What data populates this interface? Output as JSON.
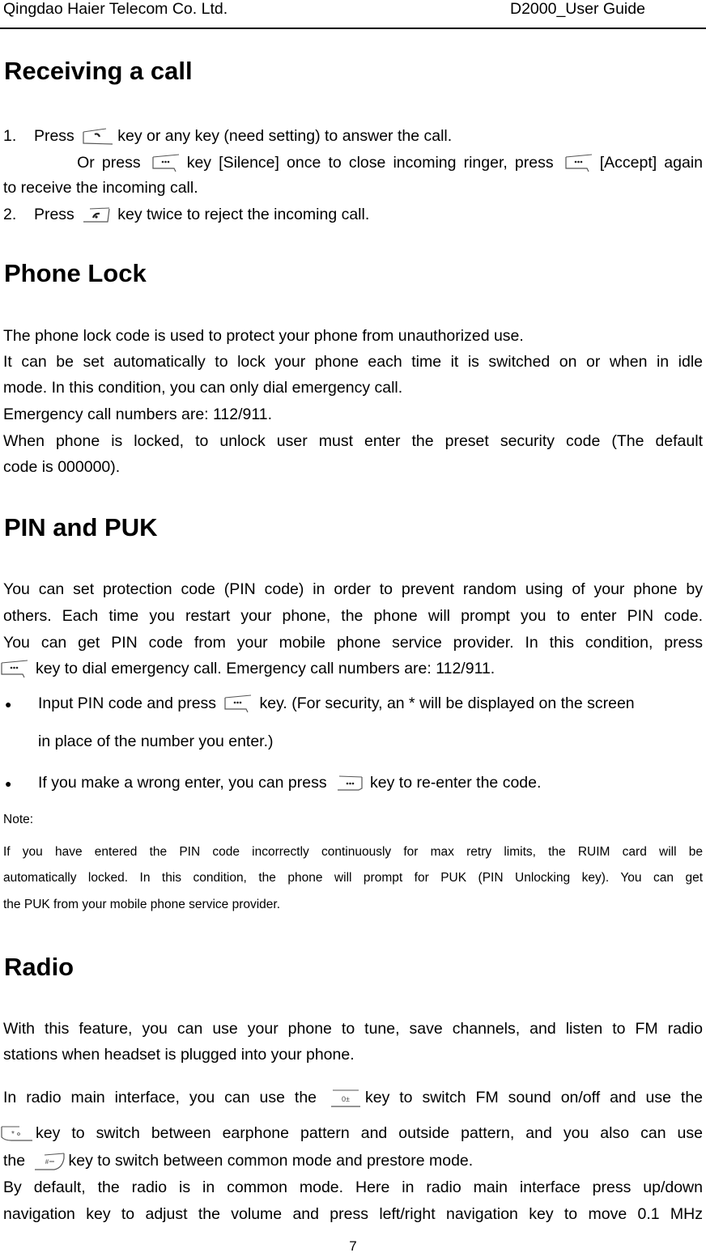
{
  "header": {
    "company": "Qingdao Haier Telecom Co. Ltd.",
    "doc_title": "D2000_User Guide"
  },
  "receiving": {
    "title": "Receiving a call",
    "l1_num": "1.",
    "l1_a": "Press",
    "l1_b": "key or any key (need setting) to answer the call.",
    "l2_a": "Or press",
    "l2_b": "key [Silence] once to close incoming ringer, press",
    "l2_c": "[Accept] again",
    "l3": "to receive the incoming call.",
    "l4_num": "2.",
    "l4_a": "Press",
    "l4_b": "key twice to reject the incoming call."
  },
  "phone_lock": {
    "title": "Phone Lock",
    "lines": [
      "The phone lock code is used to protect your phone from unauthorized use.",
      "It can be set automatically to lock your phone each time it is switched on or when in idle",
      "mode. In this condition, you can only dial emergency call.",
      "Emergency call numbers are: 112/911.",
      "When phone is locked, to unlock user must enter the preset security code (The default",
      "code is 000000)."
    ]
  },
  "pin_puk": {
    "title": "PIN and PUK",
    "lines": [
      "You can set protection code (PIN code) in order to prevent random using of your phone by",
      "others. Each time you restart your phone, the phone will prompt you to enter PIN code.",
      "You can get PIN code from your mobile phone service provider. In this condition, press"
    ],
    "l4_b": "key to dial emergency call. Emergency call numbers are: 112/911.",
    "bullet_glyph": "●",
    "b1_a": "Input PIN code and press",
    "b1_b": "key. (For security, an * will be displayed on the screen",
    "b1_c": "in place of the number you enter.)",
    "b2_a": "If you make a wrong enter, you can press",
    "b2_b": "key to re-enter the code.",
    "note_label": "Note:",
    "note_lines": [
      "If you have entered the PIN code incorrectly continuously for max retry limits, the RUIM card will be",
      "automatically locked. In this condition, the phone will prompt for PUK (PIN Unlocking key). You can get",
      "the PUK from your mobile phone service provider."
    ]
  },
  "radio": {
    "title": "Radio",
    "lines": [
      "With this feature, you can use your phone to tune, save channels, and listen to FM radio",
      "stations when headset is plugged into your phone."
    ],
    "r3_a": "In radio main interface, you can use the",
    "r3_b": "key to switch FM sound on/off and use the",
    "r4_b": "key to switch between earphone pattern and outside pattern, and you also can use",
    "r5_a": "the",
    "r5_b": "key to switch between common mode and prestore mode.",
    "lines2": [
      "By default, the radio is in common mode. Here in radio main interface press up/down",
      "navigation key to adjust the volume and press left/right navigation key to move 0.1 MHz"
    ]
  },
  "key_icons": {
    "send": "send-key-icon",
    "soft": "soft-key-icon",
    "end": "end-key-icon",
    "zero": "0±",
    "star": "*",
    "hash": "#"
  },
  "footer": {
    "page_number": "7"
  }
}
